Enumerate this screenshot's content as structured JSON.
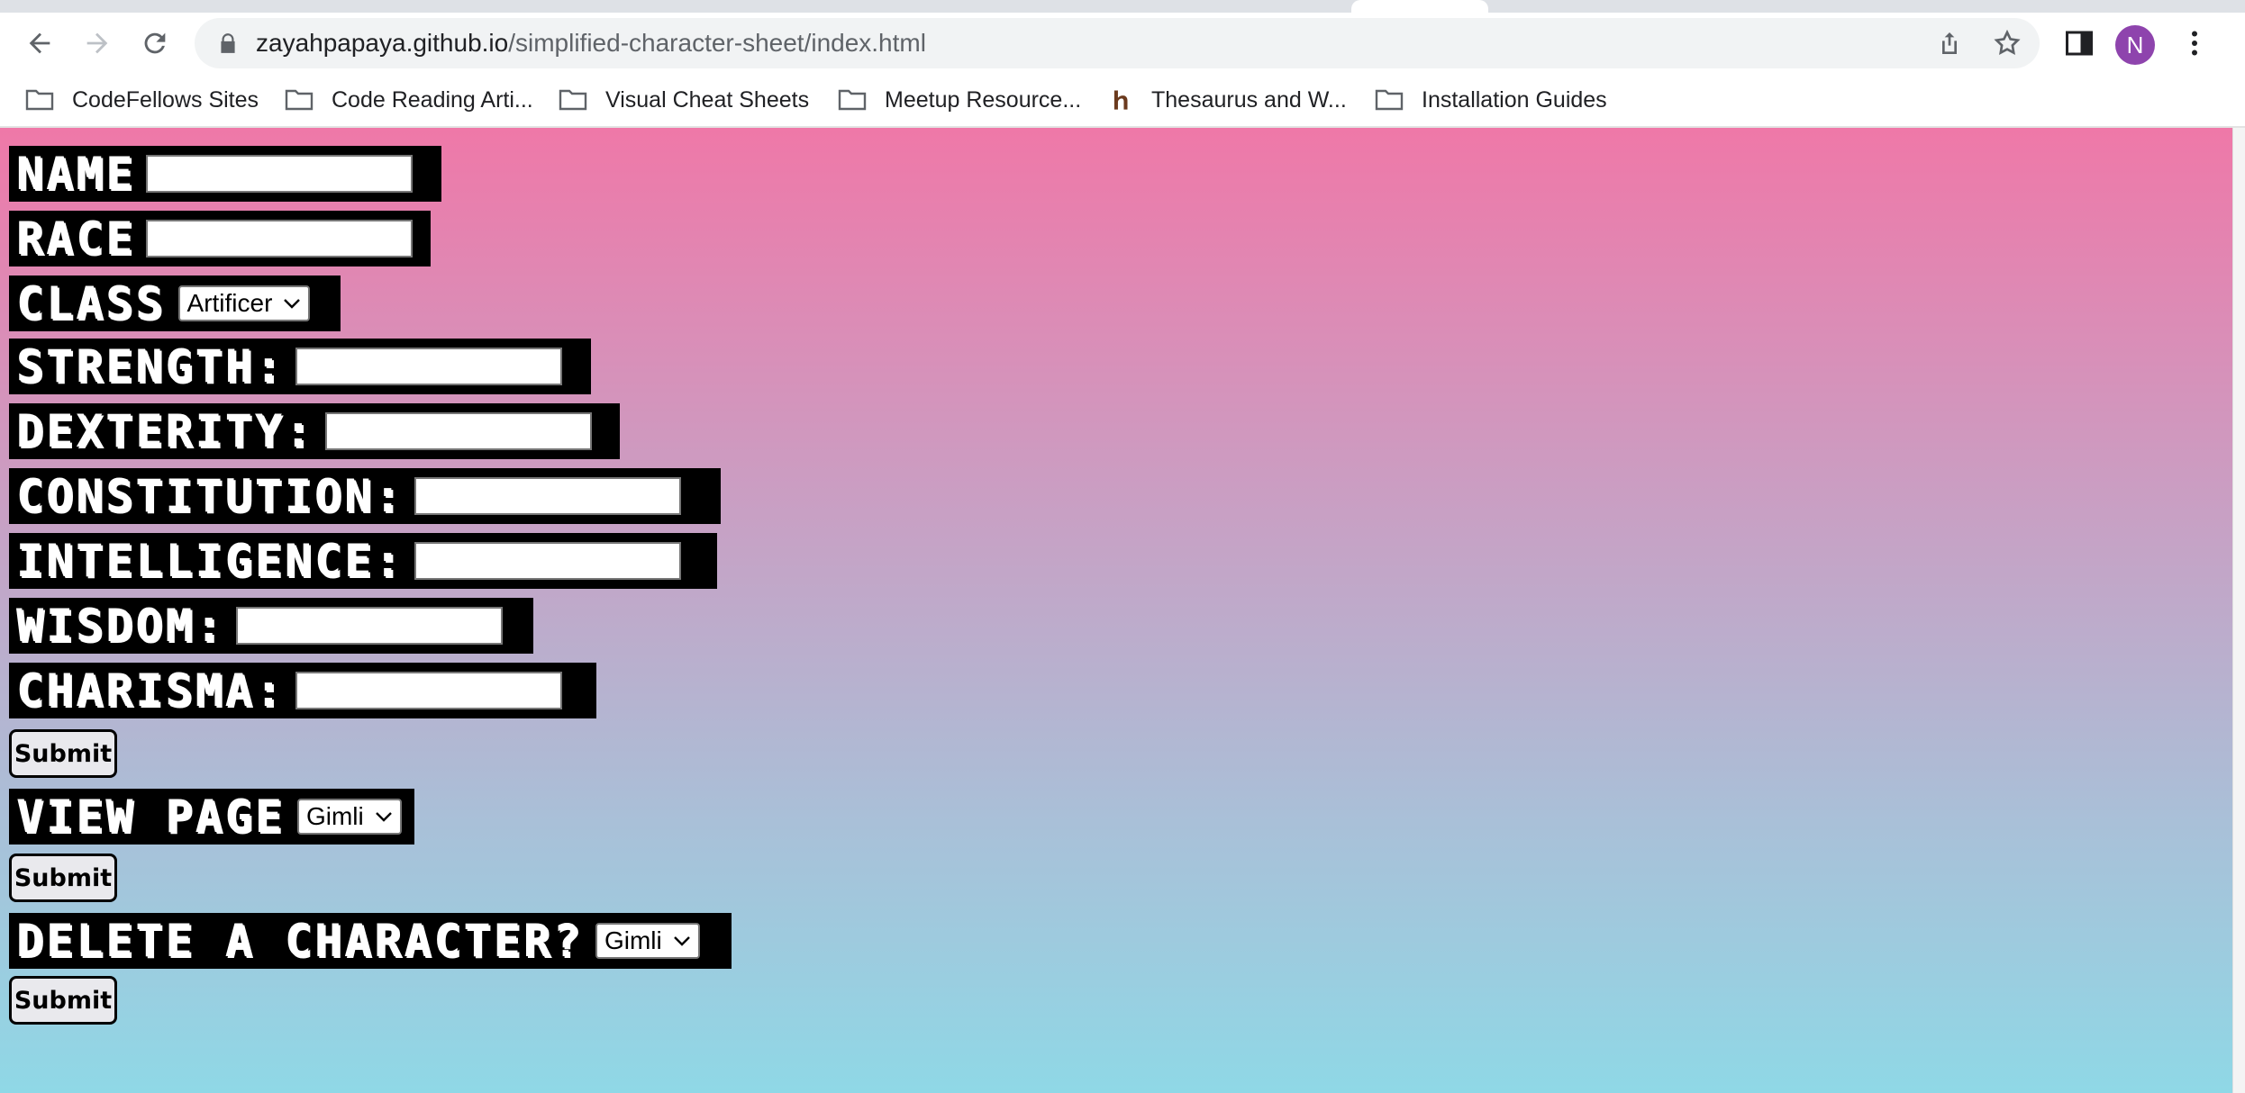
{
  "browser": {
    "url_host": "zayahpapaya.github.io",
    "url_path": "/simplified-character-sheet/index.html",
    "profile_initial": "N",
    "accent": "#8e44ad",
    "bookmarks": [
      {
        "label": "CodeFellows Sites",
        "icon": "folder-icon"
      },
      {
        "label": "Code Reading Arti...",
        "icon": "folder-icon"
      },
      {
        "label": "Visual Cheat Sheets",
        "icon": "folder-icon"
      },
      {
        "label": "Meetup Resource...",
        "icon": "folder-icon"
      },
      {
        "label": "Thesaurus and W...",
        "icon": "h-site-icon"
      },
      {
        "label": "Installation Guides",
        "icon": "folder-icon"
      }
    ]
  },
  "form": {
    "name_label": "NAME",
    "race_label": "RACE",
    "class_label": "CLASS",
    "class_selected": "Artificer",
    "strength_label": "STRENGTH:",
    "dexterity_label": "DEXTERITY:",
    "constitution_label": "CONSTITUTION:",
    "intelligence_label": "INTELLIGENCE:",
    "wisdom_label": "WISDOM:",
    "charisma_label": "CHARISMA:",
    "submit_label": "Submit"
  },
  "view": {
    "label": "VIEW PAGE",
    "selected": "Gimli",
    "submit_label": "Submit"
  },
  "delete": {
    "label": "DELETE A CHARACTER?",
    "selected": "Gimli",
    "submit_label": "Submit"
  },
  "colors": {
    "gradient_top": "#ef78a8",
    "gradient_bottom": "#8fd8e6",
    "label_bg": "#000000"
  }
}
